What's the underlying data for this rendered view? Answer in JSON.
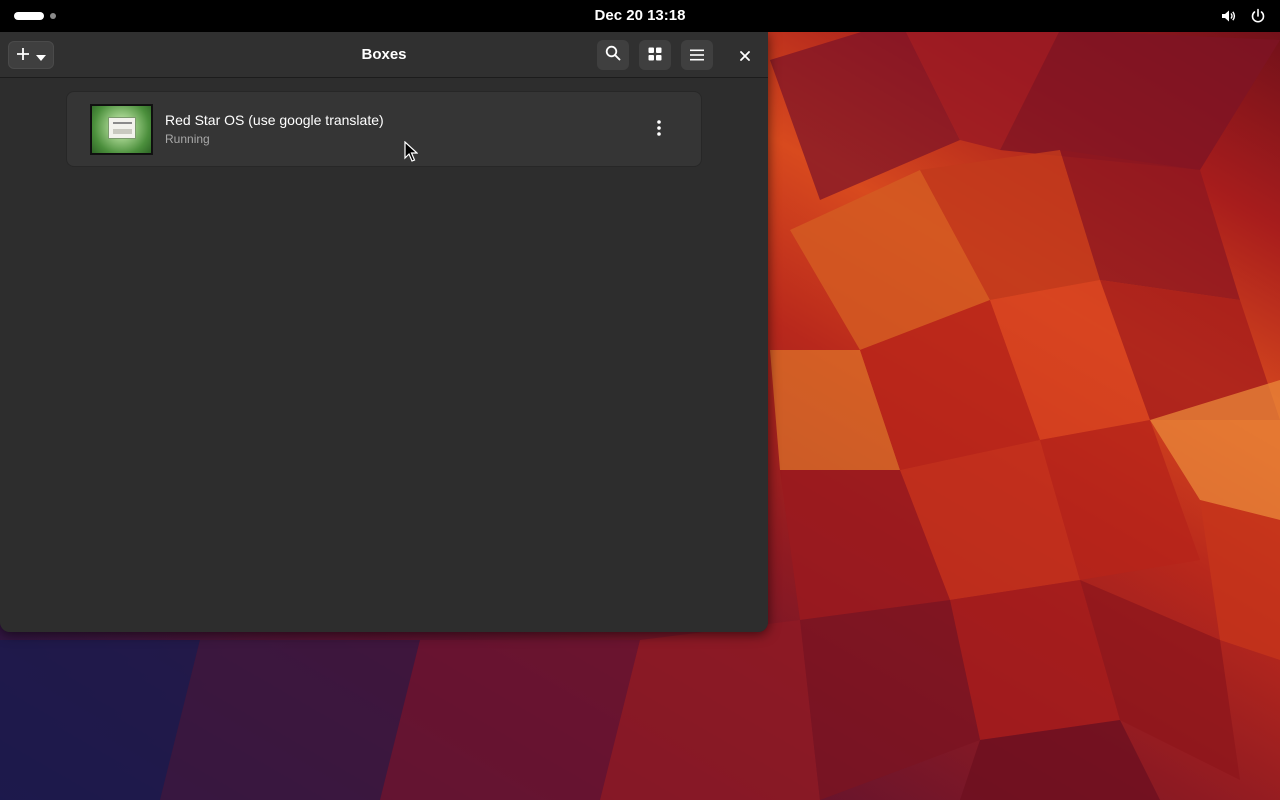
{
  "topbar": {
    "clock": "Dec 20  13:18",
    "icons": [
      "volume-icon",
      "power-icon"
    ]
  },
  "window": {
    "title": "Boxes",
    "headerbar": {
      "new_button_icons": [
        "plus-icon",
        "chevron-down-icon"
      ],
      "search_icon": "search-icon",
      "view_icon": "grid-view-icon",
      "menu_icon": "hamburger-menu-icon",
      "close_icon": "close-icon"
    },
    "boxes": [
      {
        "name": "Red Star OS (use google translate)",
        "status": "Running",
        "menu_icon": "vertical-dots-icon"
      }
    ]
  },
  "colors": {
    "topbar_bg": "#000000",
    "window_bg": "#2d2d2d",
    "headerbar_bg": "#303030",
    "row_bg": "#353535",
    "status_text": "#a8a8a8"
  }
}
